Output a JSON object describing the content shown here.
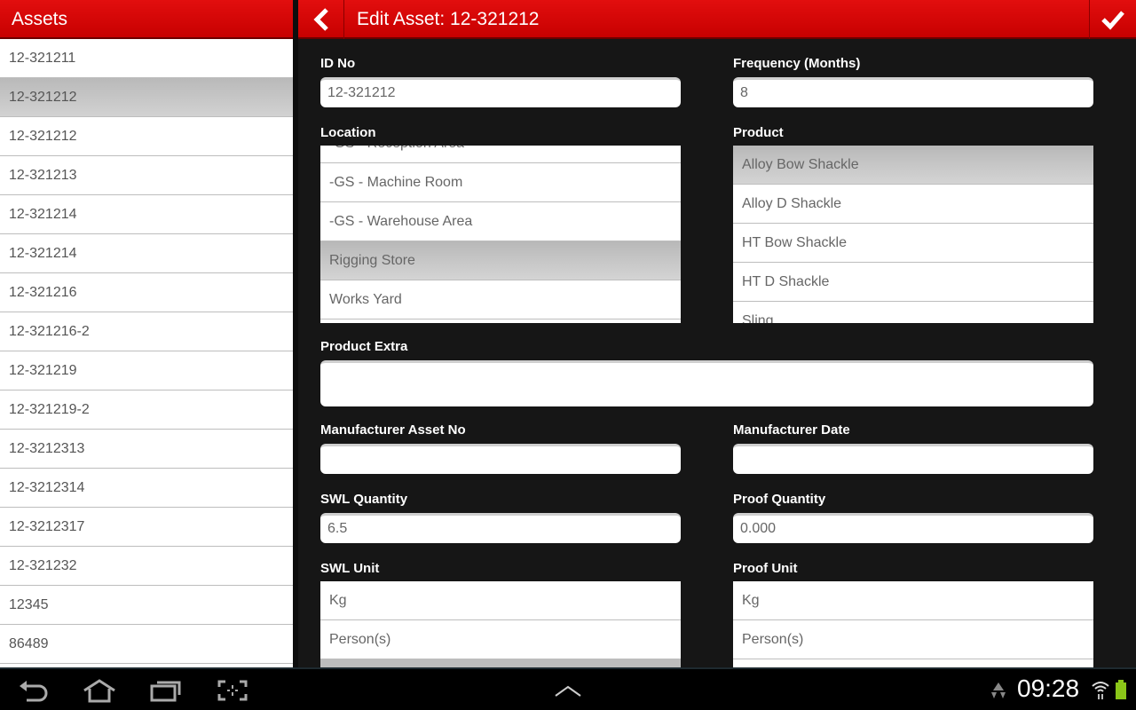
{
  "left_panel": {
    "title": "Assets",
    "items": [
      {
        "label": "12-321211",
        "selected": false
      },
      {
        "label": "12-321212",
        "selected": true
      },
      {
        "label": "12-321212",
        "selected": false
      },
      {
        "label": "12-321213",
        "selected": false
      },
      {
        "label": "12-321214",
        "selected": false
      },
      {
        "label": "12-321214",
        "selected": false
      },
      {
        "label": "12-321216",
        "selected": false
      },
      {
        "label": "12-321216-2",
        "selected": false
      },
      {
        "label": "12-321219",
        "selected": false
      },
      {
        "label": "12-321219-2",
        "selected": false
      },
      {
        "label": "12-3212313",
        "selected": false
      },
      {
        "label": "12-3212314",
        "selected": false
      },
      {
        "label": "12-3212317",
        "selected": false
      },
      {
        "label": "12-321232",
        "selected": false
      },
      {
        "label": "12345",
        "selected": false
      },
      {
        "label": "86489",
        "selected": false
      }
    ]
  },
  "header": {
    "title": "Edit Asset: 12-321212",
    "back_icon": "chevron-left-icon",
    "save_icon": "checkmark-icon"
  },
  "form": {
    "id_no": {
      "label": "ID No",
      "value": "12-321212"
    },
    "frequency": {
      "label": "Frequency (Months)",
      "value": "8"
    },
    "location": {
      "label": "Location",
      "options": [
        "-GS - Reception Area",
        "-GS - Machine Room",
        "-GS - Warehouse Area",
        "Rigging Store",
        "Works Yard"
      ],
      "selected": "Rigging Store"
    },
    "product": {
      "label": "Product",
      "options": [
        "Alloy Bow Shackle",
        "Alloy D Shackle",
        "HT Bow Shackle",
        "HT D Shackle",
        "Sling"
      ],
      "selected": "Alloy Bow Shackle"
    },
    "product_extra": {
      "label": "Product Extra",
      "value": ""
    },
    "manufacturer_asset_no": {
      "label": "Manufacturer Asset No",
      "value": ""
    },
    "manufacturer_date": {
      "label": "Manufacturer Date",
      "value": ""
    },
    "swl_quantity": {
      "label": "SWL Quantity",
      "value": "6.5"
    },
    "proof_quantity": {
      "label": "Proof Quantity",
      "value": "0.000"
    },
    "swl_unit": {
      "label": "SWL Unit",
      "options": [
        "Kg",
        "Person(s)"
      ]
    },
    "proof_unit": {
      "label": "Proof Unit",
      "options": [
        "Kg",
        "Person(s)"
      ]
    }
  },
  "system_bar": {
    "nav_icons": [
      "back-icon",
      "home-icon",
      "recent-apps-icon",
      "screenshot-icon"
    ],
    "clock": "09:28",
    "battery_color": "#8bc619"
  }
}
